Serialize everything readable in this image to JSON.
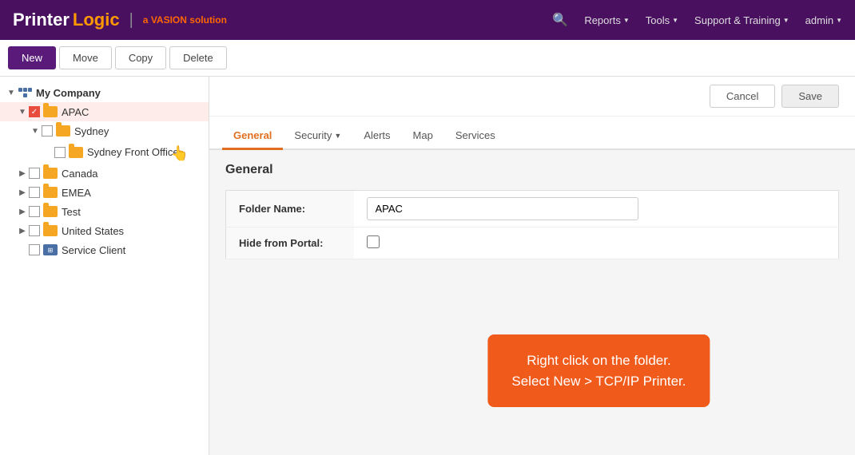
{
  "app": {
    "logo_printer": "Printer",
    "logo_logic": "Logic",
    "logo_vasion": "a ",
    "logo_vasion_brand": "VASION",
    "logo_vasion_suffix": " solution"
  },
  "topnav": {
    "search_label": "🔍",
    "reports_label": "Reports",
    "tools_label": "Tools",
    "support_label": "Support & Training",
    "admin_label": "admin"
  },
  "toolbar": {
    "new_label": "New",
    "move_label": "Move",
    "copy_label": "Copy",
    "delete_label": "Delete"
  },
  "sidebar": {
    "root_label": "My Company",
    "items": [
      {
        "label": "APAC",
        "indent": 1,
        "checked": true,
        "expanded": true
      },
      {
        "label": "Sydney",
        "indent": 2,
        "checked": false,
        "expanded": true
      },
      {
        "label": "Sydney Front Office",
        "indent": 3,
        "checked": false
      },
      {
        "label": "Canada",
        "indent": 1,
        "checked": false
      },
      {
        "label": "EMEA",
        "indent": 1,
        "checked": false
      },
      {
        "label": "Test",
        "indent": 1,
        "checked": false
      },
      {
        "label": "United States",
        "indent": 1,
        "checked": false
      },
      {
        "label": "Service Client",
        "indent": 1,
        "checked": false,
        "special": true
      }
    ]
  },
  "tabs": [
    {
      "label": "General",
      "active": true
    },
    {
      "label": "Security",
      "dropdown": true
    },
    {
      "label": "Alerts"
    },
    {
      "label": "Map"
    },
    {
      "label": "Services"
    }
  ],
  "form": {
    "title": "General",
    "cancel_label": "Cancel",
    "save_label": "Save",
    "folder_name_label": "Folder Name:",
    "folder_name_value": "APAC",
    "hide_portal_label": "Hide from Portal:"
  },
  "callout": {
    "line1": "Right click on the folder.",
    "line2": "Select New > TCP/IP Printer."
  }
}
